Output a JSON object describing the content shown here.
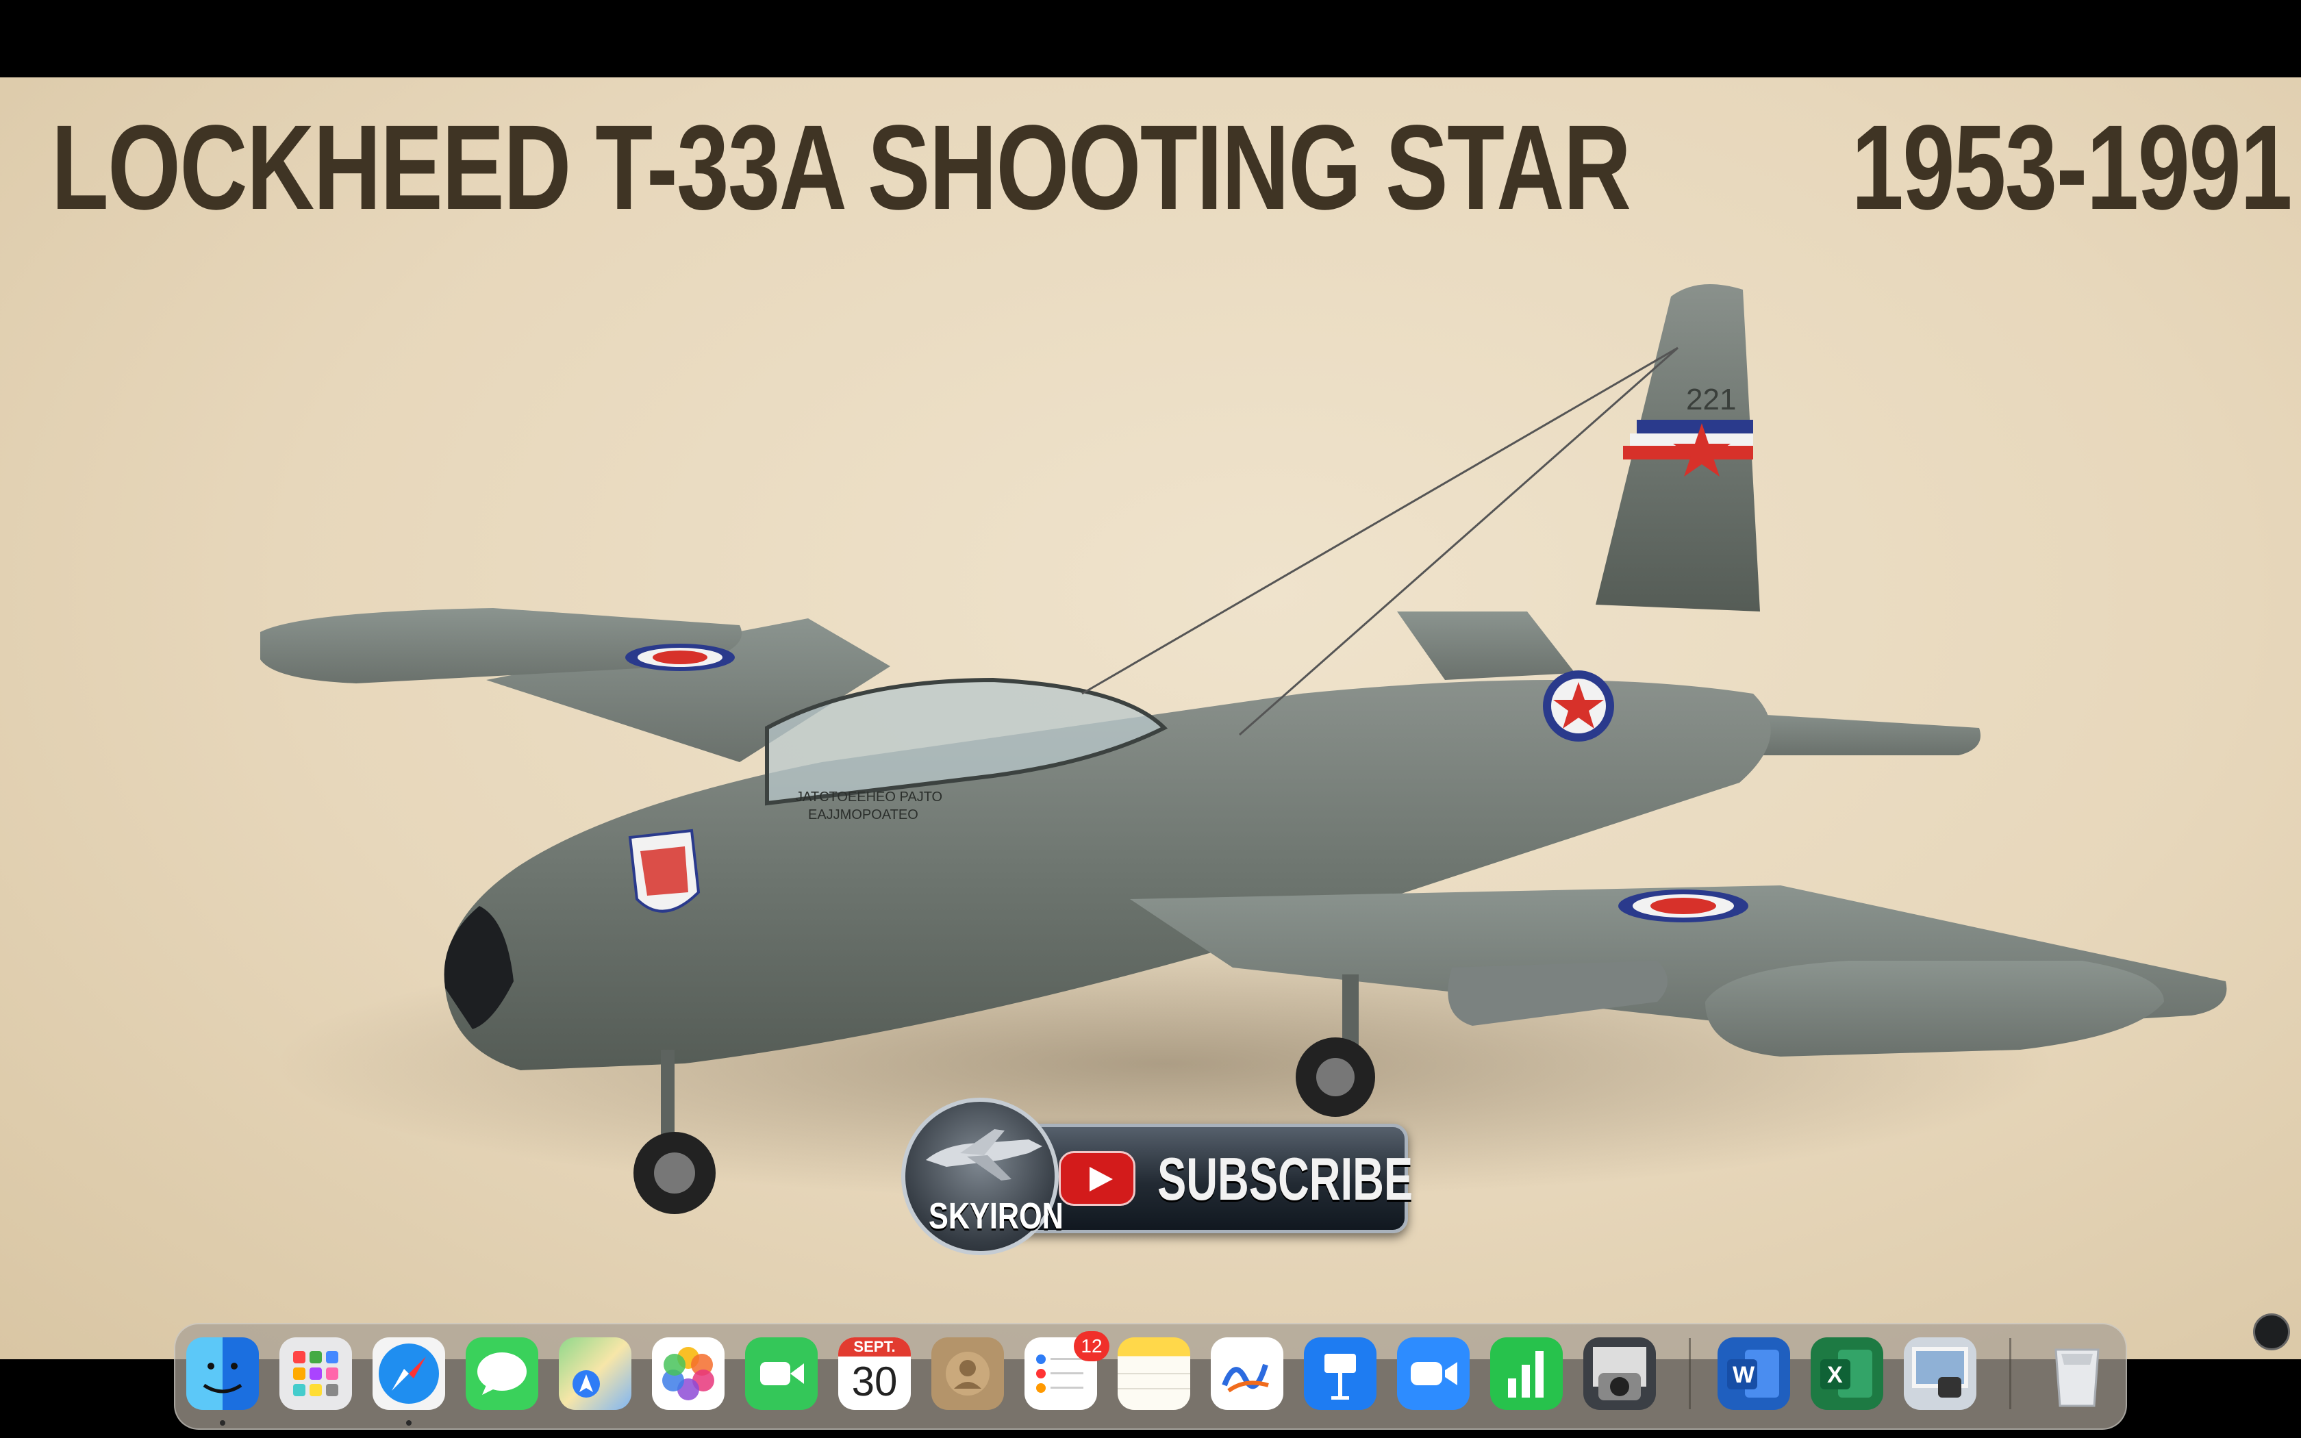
{
  "video": {
    "title_left": "LOCKHEED T-33A SHOOTING STAR",
    "title_right": "1953-1991",
    "tail_number": "221",
    "nose_text_line1": "JATCTOEEHEO PAJTO",
    "nose_text_line2": "EAJJMOPOATEO",
    "subscribe_label": "SUBSCRIBE",
    "channel_badge": "SKYIRON"
  },
  "dock": {
    "apps": [
      "Finder",
      "Launchpad",
      "Safari",
      "Messages",
      "Maps",
      "Photos",
      "FaceTime",
      "Calendar",
      "Contacts",
      "Reminders",
      "Notes",
      "Freeform",
      "Keynote",
      "Zoom",
      "Numbers",
      "Image Capture",
      "Microsoft Word",
      "Microsoft Excel",
      "Preview",
      "Trash"
    ],
    "calendar_month": "SEPT.",
    "calendar_day": "30",
    "reminders_badge": "12",
    "running_indicators": [
      "Finder",
      "Safari"
    ]
  },
  "colors": {
    "background": "#e9dbc1",
    "title": "#3f3424",
    "roundel_red": "#d7312a",
    "roundel_blue": "#2a3a8c"
  },
  "icons": [
    "finder-icon",
    "launchpad-icon",
    "safari-icon",
    "messages-icon",
    "maps-icon",
    "photos-icon",
    "facetime-icon",
    "calendar-icon",
    "contacts-icon",
    "reminders-icon",
    "notes-icon",
    "freeform-icon",
    "keynote-icon",
    "zoom-icon",
    "numbers-icon",
    "image-capture-icon",
    "word-icon",
    "excel-icon",
    "preview-icon",
    "trash-icon",
    "screenshot-icon"
  ]
}
